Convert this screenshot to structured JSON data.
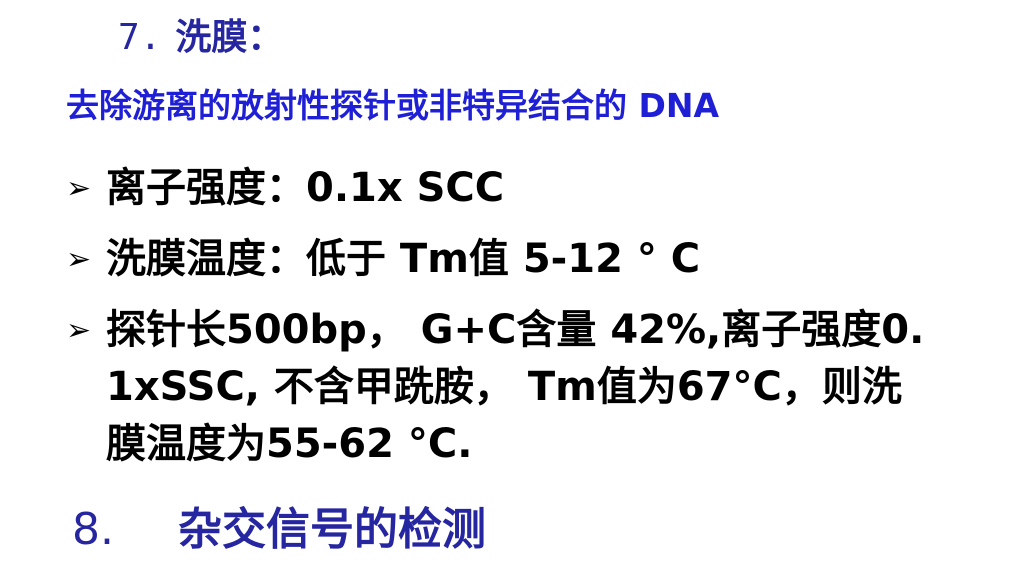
{
  "section7": {
    "number": "7.",
    "title": "洗膜："
  },
  "subtitle": "去除游离的放射性探针或非特异结合的 DNA",
  "bullet_icon": "arrowhead-bullet",
  "bullets": [
    "离子强度：0.1x SCC",
    "洗膜温度：低于 Tm值 5-12 ° C",
    "探针长500bp， G+C含量 42%,离子强度0.1xSSC, 不含甲跣胺， Tm值为67°C，则洗膜温度为55-62 °C."
  ],
  "section8": {
    "number": "8.",
    "title": "杂交信号的检测"
  },
  "colors": {
    "heading": "#2626a0",
    "subtitle": "#1f1fd6",
    "body": "#000000"
  }
}
